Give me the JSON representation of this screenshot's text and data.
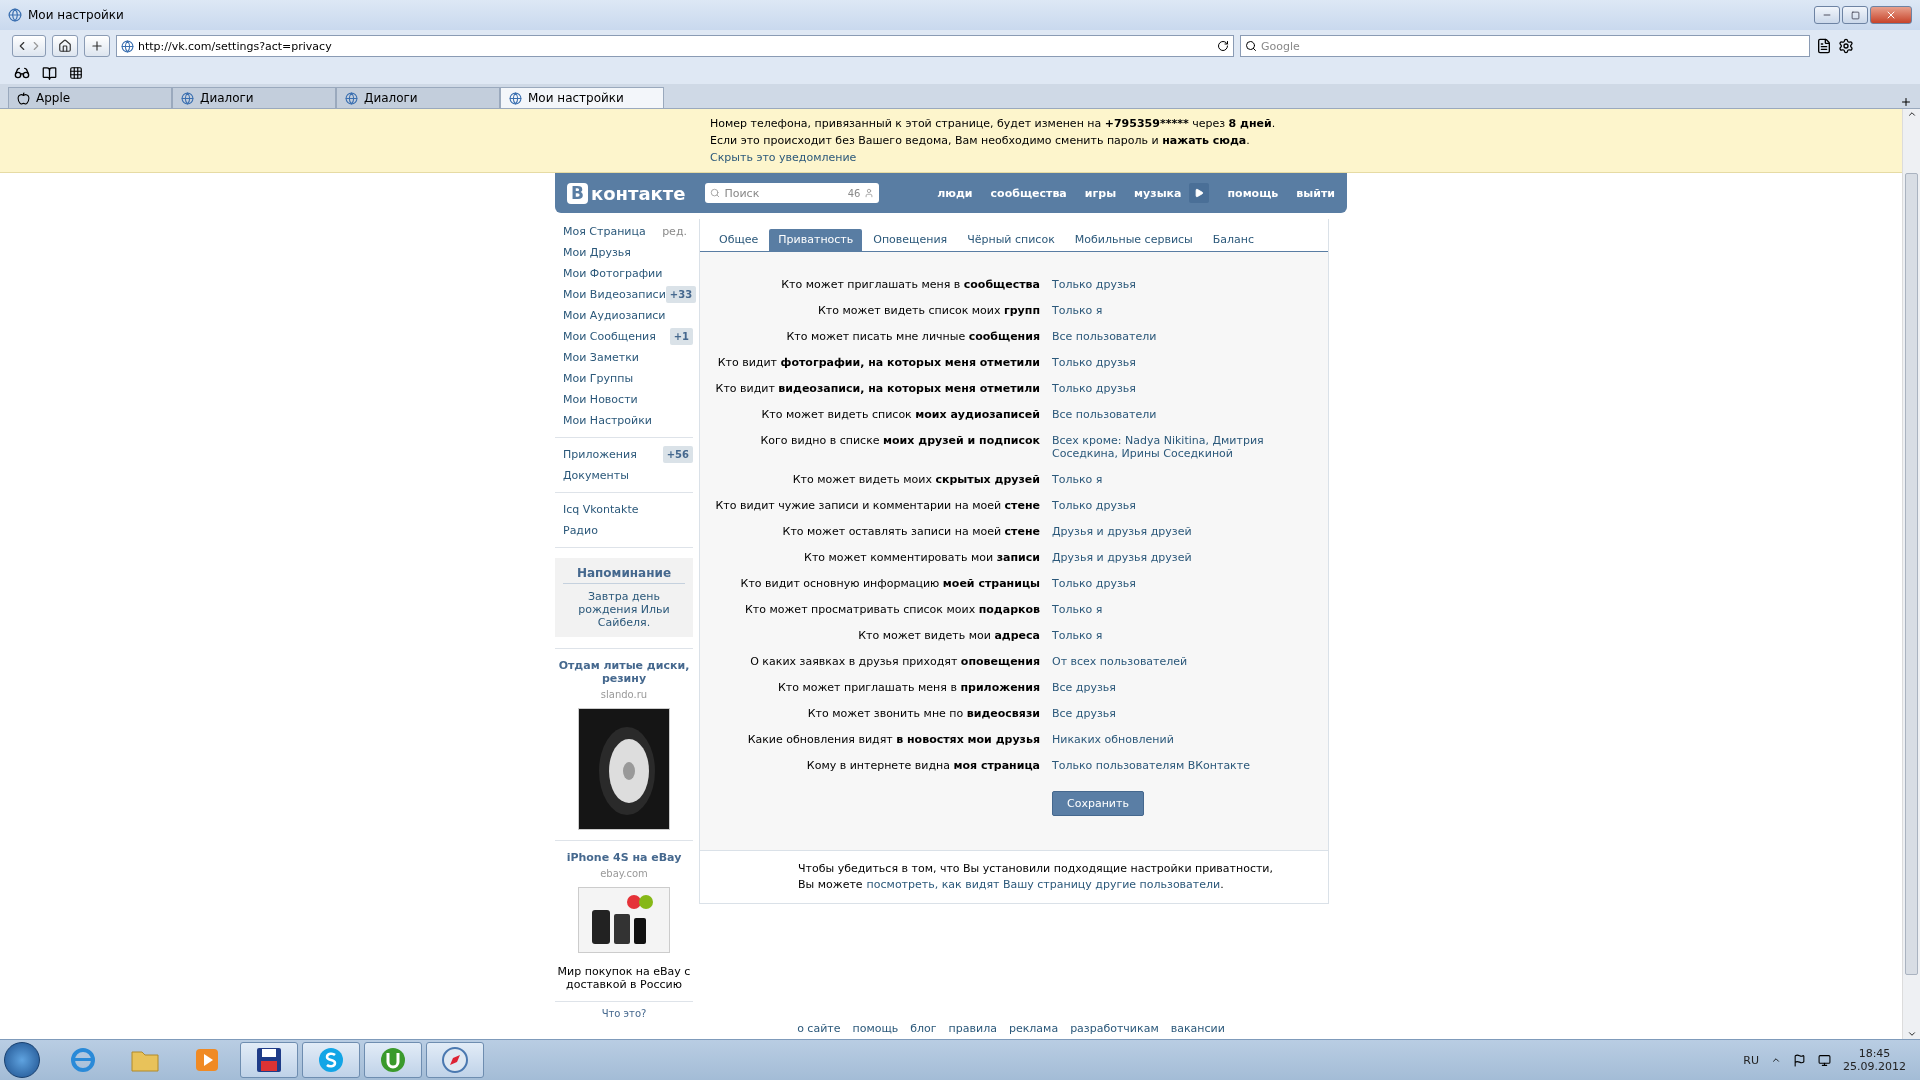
{
  "window": {
    "title": "Мои настройки"
  },
  "browser": {
    "url": "http://vk.com/settings?act=privacy",
    "search_placeholder": "Google",
    "tabs": [
      {
        "label": "Apple",
        "kind": "apple",
        "selected": false
      },
      {
        "label": "Диалоги",
        "kind": "globe",
        "selected": false
      },
      {
        "label": "Диалоги",
        "kind": "globe",
        "selected": false
      },
      {
        "label": "Мои настройки",
        "kind": "globe",
        "selected": true
      }
    ]
  },
  "notice": {
    "line1": [
      {
        "text": "Номер телефона, привязанный к этой странице, будет изменен на ",
        "bold": false
      },
      {
        "text": "+795359*****",
        "bold": true
      },
      {
        "text": " через ",
        "bold": false
      },
      {
        "text": "8 дней",
        "bold": true
      },
      {
        "text": ".",
        "bold": false
      }
    ],
    "line2": "Если это происходит без Вашего ведома, Вам необходимо сменить пароль и **нажать сюда**.",
    "hide_link": "Скрыть это уведомление"
  },
  "header": {
    "logo_mark": "В",
    "logo_text": "контакте",
    "search_placeholder": "Поиск",
    "search_count": "46",
    "nav": [
      "люди",
      "сообщества",
      "игры",
      "музыка"
    ],
    "nav_after": [
      "помощь",
      "выйти"
    ]
  },
  "sidebar": {
    "edit_link": "ред.",
    "groups": [
      [
        {
          "label": "Моя Страница"
        },
        {
          "label": "Мои Друзья"
        },
        {
          "label": "Мои Фотографии"
        },
        {
          "label": "Мои Видеозаписи",
          "badge": "+33"
        },
        {
          "label": "Мои Аудиозаписи"
        },
        {
          "label": "Мои Сообщения",
          "badge": "+1"
        },
        {
          "label": "Мои Заметки"
        },
        {
          "label": "Мои Группы"
        },
        {
          "label": "Мои Новости"
        },
        {
          "label": "Мои Настройки"
        }
      ],
      [
        {
          "label": "Приложения",
          "badge": "+56"
        },
        {
          "label": "Документы"
        }
      ],
      [
        {
          "label": "Icq Vkontakte"
        },
        {
          "label": "Радио"
        }
      ]
    ]
  },
  "reminder": {
    "title": "Напоминание",
    "text": "Завтра день рождения Ильи Сайбеля."
  },
  "ads": [
    {
      "title": "Отдам литые диски, резину",
      "domain": "slando.ru",
      "kind": "wheel"
    },
    {
      "title": "iPhone 4S на eBay",
      "domain": "ebay.com",
      "kind": "phones",
      "caption": "Мир покупок на eBay с доставкой в Россию"
    }
  ],
  "ads_help": "Что это?",
  "settings_tabs": [
    {
      "label": "Общее",
      "selected": false
    },
    {
      "label": "Приватность",
      "selected": true
    },
    {
      "label": "Оповещения",
      "selected": false
    },
    {
      "label": "Чёрный список",
      "selected": false
    },
    {
      "label": "Мобильные сервисы",
      "selected": false
    },
    {
      "label": "Баланс",
      "selected": false
    }
  ],
  "privacy_rows": [
    {
      "label": "Кто может приглашать меня в **сообщества**",
      "value": "Только друзья"
    },
    {
      "label": "Кто может видеть список моих **групп**",
      "value": "Только я"
    },
    {
      "label": "Кто может писать мне личные **сообщения**",
      "value": "Все пользователи"
    },
    {
      "label": "Кто видит **фотографии, на которых меня отметили**",
      "value": "Только друзья"
    },
    {
      "label": "Кто видит **видеозаписи, на которых меня отметили**",
      "value": "Только друзья"
    },
    {
      "label": "Кто может видеть список **моих аудиозаписей**",
      "value": "Все пользователи"
    },
    {
      "label": "Кого видно в списке **моих друзей и подписок**",
      "value": "Всех кроме: Nadya Nikitina, Дмитрия Соседкина, Ирины Соседкиной"
    },
    {
      "label": "Кто может видеть моих **скрытых друзей**",
      "value": "Только я"
    },
    {
      "label": "Кто видит чужие записи и комментарии на моей **стене**",
      "value": "Только друзья"
    },
    {
      "label": "Кто может оставлять записи на моей **стене**",
      "value": "Друзья и друзья друзей"
    },
    {
      "label": "Кто может комментировать мои **записи**",
      "value": "Друзья и друзья друзей"
    },
    {
      "label": "Кто видит основную информацию **моей страницы**",
      "value": "Только друзья"
    },
    {
      "label": "Кто может просматривать список моих **подарков**",
      "value": "Только я"
    },
    {
      "label": "Кто может видеть мои **адреса**",
      "value": "Только я"
    },
    {
      "label": "О каких заявках в друзья приходят **оповещения**",
      "value": "От всех пользователей"
    },
    {
      "label": "Кто может приглашать меня в **приложения**",
      "value": "Все друзья"
    },
    {
      "label": "Кто может звонить мне по **видеосвязи**",
      "value": "Все друзья"
    },
    {
      "label": "Какие обновления видят **в новостях мои друзья**",
      "value": "Никаких обновлений"
    },
    {
      "label": "Кому в интернете видна **моя страница**",
      "value": "Только пользователям ВКонтакте"
    }
  ],
  "save_button": "Сохранить",
  "note": {
    "line1": "Чтобы убедиться в том, что Вы установили подходящие настройки приватности,",
    "line2_prefix": "Вы можете",
    "link": "посмотреть, как видят Вашу страницу другие пользователи",
    "suffix": "."
  },
  "footer": [
    "о сайте",
    "помощь",
    "блог",
    "правила",
    "реклама",
    "разработчикам",
    "вакансии"
  ],
  "taskbar": {
    "apps": [
      {
        "kind": "ie",
        "selected": false
      },
      {
        "kind": "folder",
        "selected": false
      },
      {
        "kind": "media",
        "selected": false
      },
      {
        "kind": "disk",
        "selected": true
      },
      {
        "kind": "skype",
        "selected": true
      },
      {
        "kind": "torrent",
        "selected": true
      },
      {
        "kind": "compass",
        "selected": true
      }
    ],
    "language": "RU",
    "time": "18:45",
    "date": "25.09.2012"
  }
}
